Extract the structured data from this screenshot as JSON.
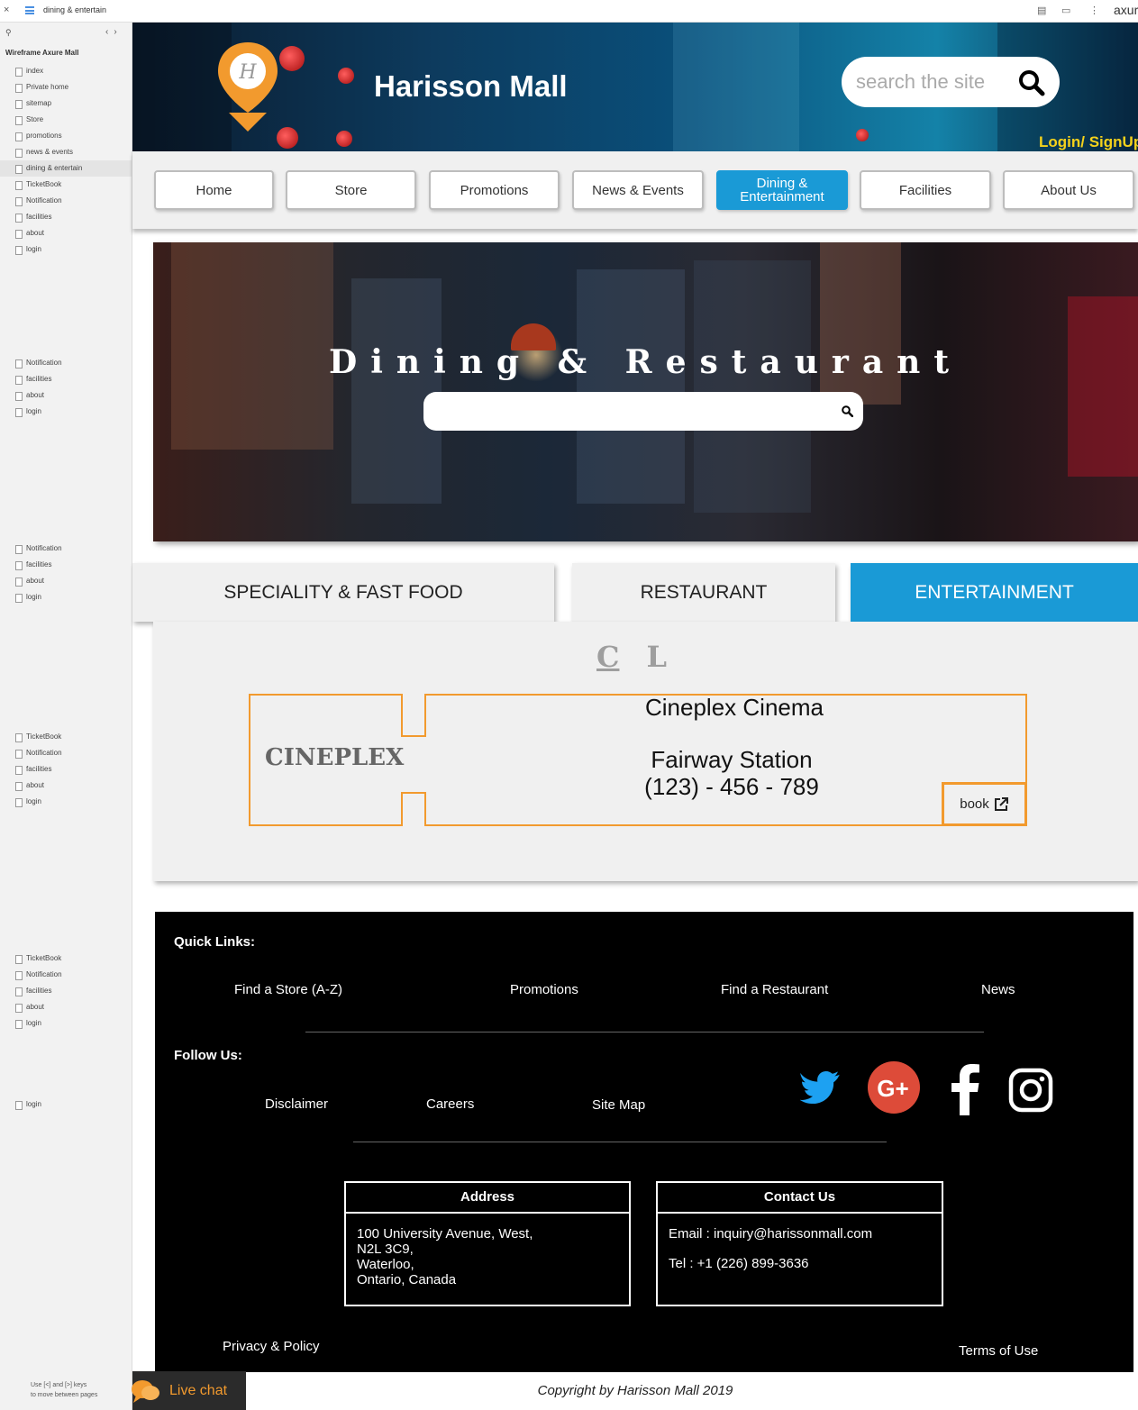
{
  "toolbar": {
    "close": "×",
    "page_title": "dining & entertain",
    "brand": "axur"
  },
  "sidebar": {
    "project": "Wireframe Axure Mall",
    "groups": [
      [
        "index",
        "Private home",
        "sitemap",
        "Store",
        "promotions",
        "news & events",
        "dining & entertain",
        "TicketBook",
        "Notification",
        "facilities",
        "about",
        "login"
      ],
      [
        "Notification",
        "facilities",
        "about",
        "login"
      ],
      [
        "Notification",
        "facilities",
        "about",
        "login"
      ],
      [
        "TicketBook",
        "Notification",
        "facilities",
        "about",
        "login"
      ],
      [
        "TicketBook",
        "Notification",
        "facilities",
        "about",
        "login"
      ],
      [
        "login"
      ]
    ],
    "hint_line1": "Use [<] and [>] keys",
    "hint_line2": "to move between pages"
  },
  "header": {
    "title": "Harisson Mall",
    "search_placeholder": "search the site",
    "login": "Login/ SignUp"
  },
  "nav": {
    "items": [
      {
        "label": "Home"
      },
      {
        "label": "Store"
      },
      {
        "label": "Promotions"
      },
      {
        "label": "News & Events"
      },
      {
        "label": "Dining & Entertainment",
        "active": true
      },
      {
        "label": "Facilities"
      },
      {
        "label": "About Us"
      }
    ],
    "accent": "#1a9ad6"
  },
  "banner": {
    "title": "Dining & Restaurant",
    "search_placeholder": ""
  },
  "categories": [
    {
      "label": "SPECIALITY & FAST FOOD"
    },
    {
      "label": "RESTAURANT"
    },
    {
      "label": "ENTERTAINMENT",
      "active": true
    }
  ],
  "letters": [
    "C",
    "L"
  ],
  "listing": {
    "logo_text": "CINEPLEX",
    "name": "Cineplex Cinema",
    "location": "Fairway Station",
    "phone": "(123) - 456 - 789",
    "book": "book",
    "border_color": "#f29a2e"
  },
  "footer": {
    "quick_links_title": "Quick Links:",
    "quick_links": [
      "Find a Store (A-Z)",
      "Promotions",
      "Find a Restaurant",
      "News"
    ],
    "follow_title": "Follow Us:",
    "follow_links": [
      "Disclaimer",
      "Careers",
      "Site Map"
    ],
    "social_icons": [
      "twitter-icon",
      "google-plus-icon",
      "facebook-icon",
      "instagram-icon"
    ],
    "address_title": "Address",
    "address_lines": [
      "100 University Avenue, West,",
      "N2L 3C9,",
      "Waterloo,",
      "Ontario, Canada"
    ],
    "contact_title": "Contact Us",
    "contact_email": "Email : inquiry@harissonmall.com",
    "contact_tel": "Tel : +1 (226) 899-3636",
    "privacy": "Privacy & Policy",
    "terms": "Terms of Use"
  },
  "copyright": "Copyright by Harisson Mall  2019",
  "live_chat": "Live chat"
}
